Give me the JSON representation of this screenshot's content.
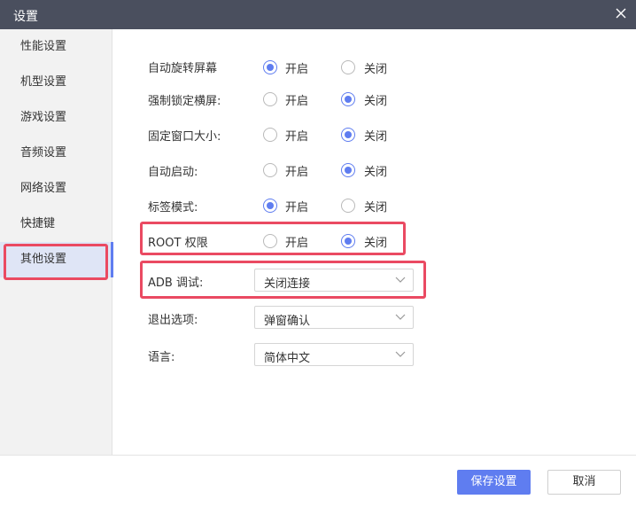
{
  "window": {
    "title": "设置"
  },
  "sidebar": {
    "items": [
      {
        "label": "性能设置"
      },
      {
        "label": "机型设置"
      },
      {
        "label": "游戏设置"
      },
      {
        "label": "音频设置"
      },
      {
        "label": "网络设置"
      },
      {
        "label": "快捷键"
      },
      {
        "label": "其他设置",
        "active": true
      }
    ]
  },
  "options": {
    "on_label": "开启",
    "off_label": "关闭",
    "auto_rotate": {
      "label": "自动旋转屏幕",
      "selected": "开启"
    },
    "force_landscape": {
      "label": "强制锁定横屏:",
      "selected": "关闭"
    },
    "fixed_window": {
      "label": "固定窗口大小:",
      "selected": "关闭"
    },
    "auto_start": {
      "label": "自动启动:",
      "selected": "关闭"
    },
    "tab_mode": {
      "label": "标签模式:",
      "selected": "开启"
    },
    "root": {
      "label": "ROOT 权限",
      "selected": "关闭"
    }
  },
  "selects": {
    "adb": {
      "label": "ADB 调试:",
      "value": "关闭连接"
    },
    "exit": {
      "label": "退出选项:",
      "value": "弹窗确认"
    },
    "language": {
      "label": "语言:",
      "value": "简体中文"
    }
  },
  "footer": {
    "save_label": "保存设置",
    "cancel_label": "取消"
  },
  "colors": {
    "accent": "#5f7df0",
    "highlight": "#ea4a62",
    "titlebar": "#4a4f5e",
    "sidebar_active": "#dfe5f6"
  }
}
